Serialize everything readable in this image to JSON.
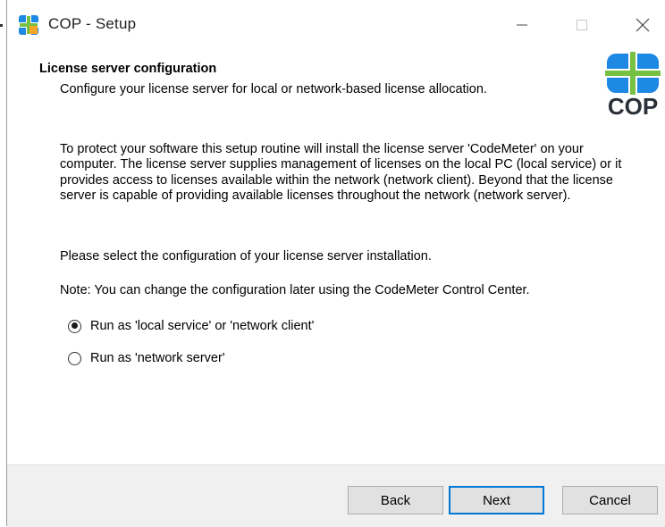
{
  "window": {
    "title": "COP - Setup"
  },
  "header": {
    "title": "License server configuration",
    "subtitle": "Configure your license server for local or network-based license allocation.",
    "logo_text": "COP"
  },
  "body": {
    "paragraph1": "To protect your software this setup routine will install the license server 'CodeMeter' on your computer. The license server supplies management of licenses on the local PC (local service) or it provides access to licenses available within the network (network client). Beyond that the license server is capable of providing available licenses throughout the network (network server).",
    "paragraph2": "Please select the configuration of your license server installation.",
    "paragraph3": "Note: You can change the configuration later using the CodeMeter Control Center.",
    "options": [
      {
        "label": "Run as 'local service' or 'network client'",
        "checked": true
      },
      {
        "label": "Run as 'network server'",
        "checked": false
      }
    ]
  },
  "footer": {
    "back_label": "Back",
    "next_label": "Next",
    "cancel_label": "Cancel"
  },
  "colors": {
    "accent": "#0078d7",
    "logo_blue": "#1e88e5",
    "logo_green": "#76c043",
    "logo_text": "#2b3138"
  },
  "icons": [
    "app-icon",
    "minimize-icon",
    "maximize-icon",
    "close-icon",
    "cop-logo"
  ]
}
